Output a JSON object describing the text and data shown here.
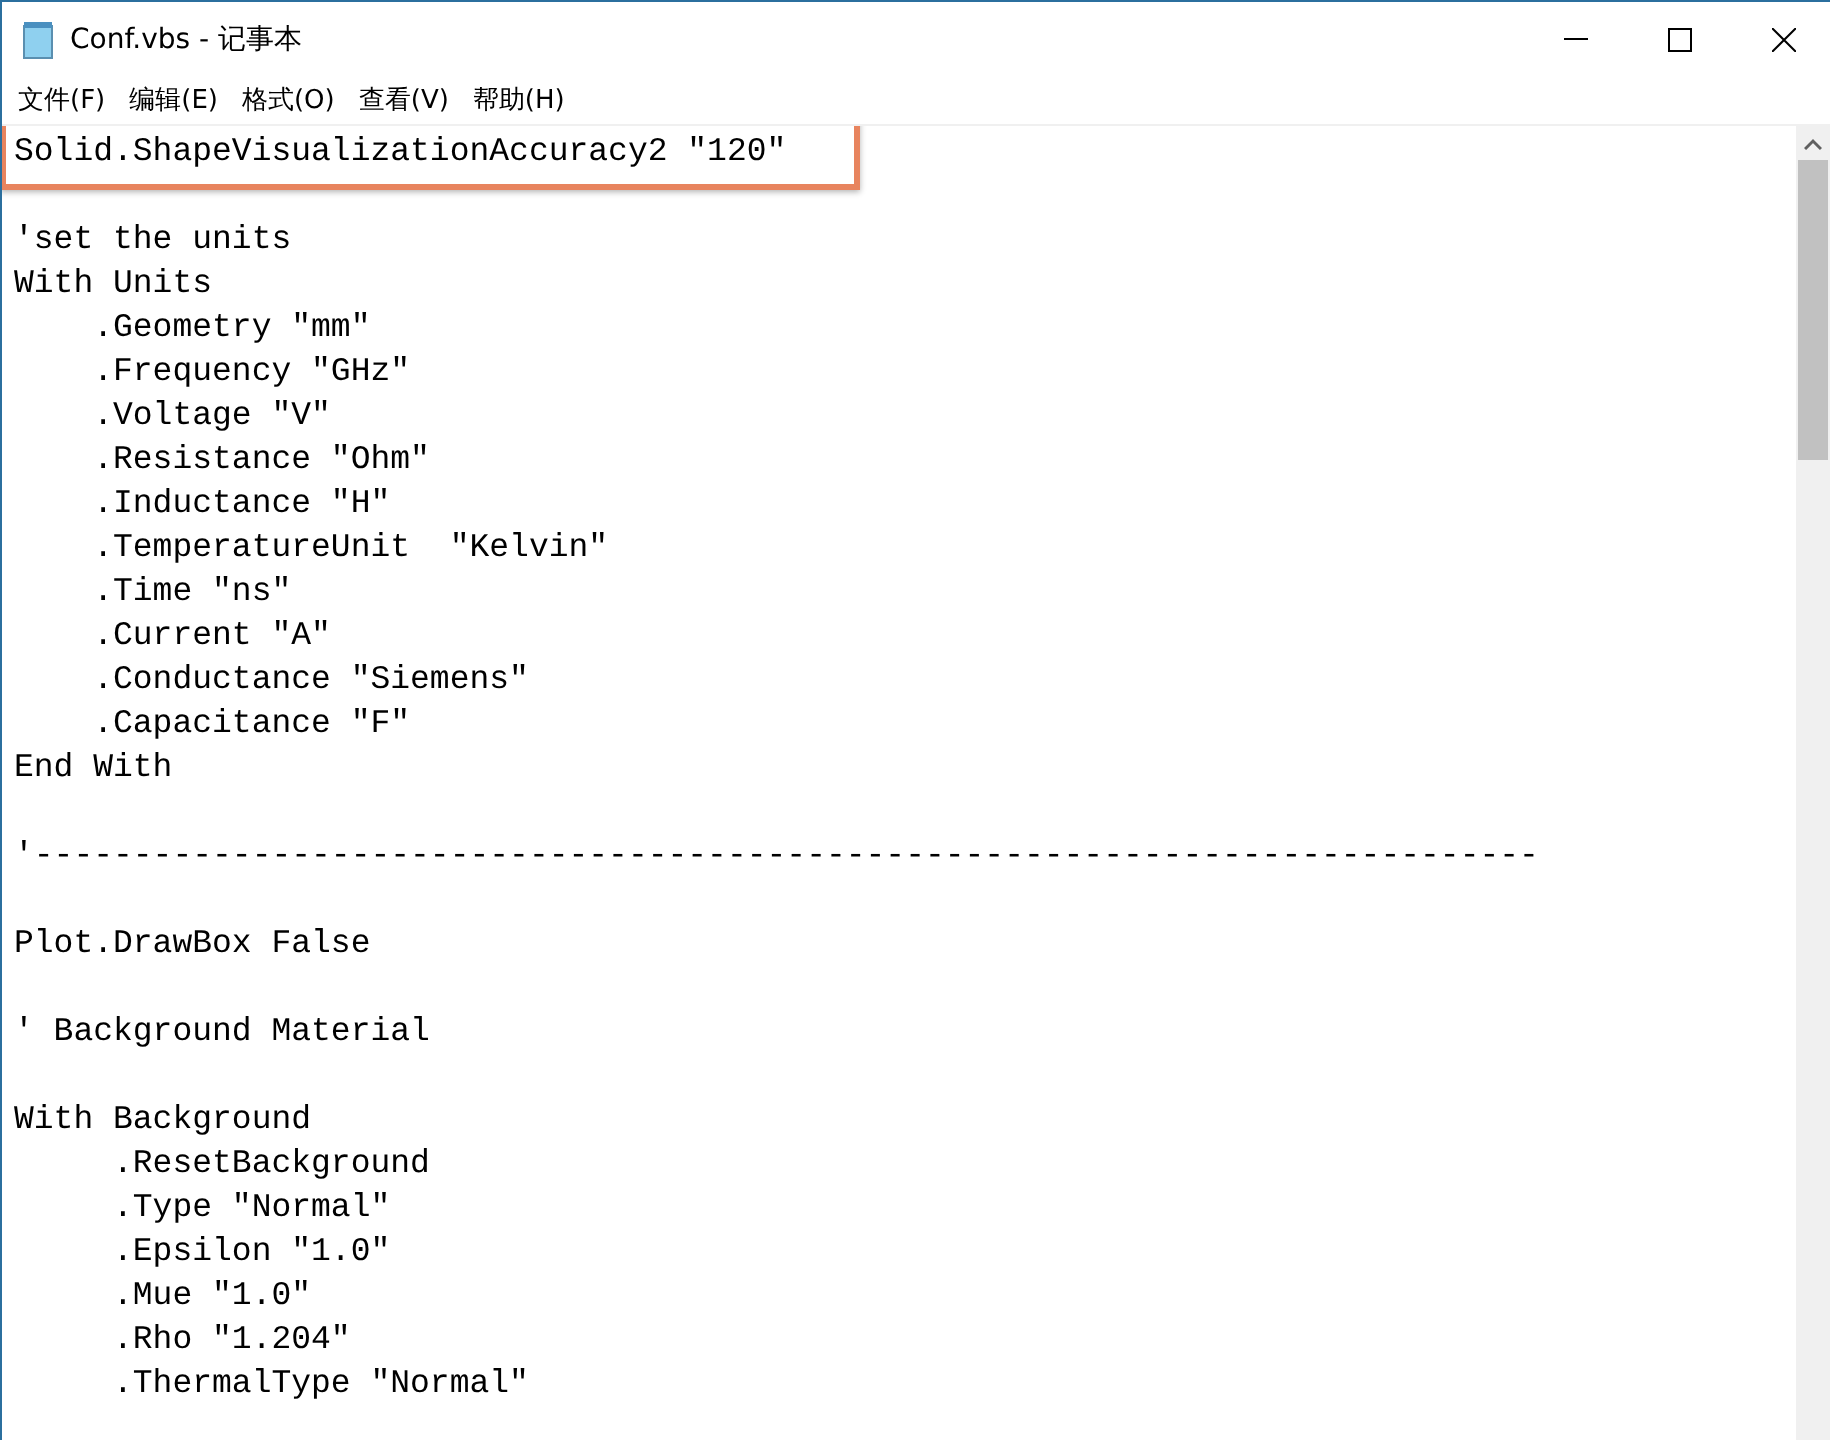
{
  "window": {
    "title": "Conf.vbs - 记事本"
  },
  "menu": [
    "文件(F)",
    "编辑(E)",
    "格式(O)",
    "查看(V)",
    "帮助(H)"
  ],
  "lines": [
    {
      "kind": "code",
      "text": "Solid.ShapeVisualizationAccuracy2 \"120\"",
      "highlighted": true
    },
    {
      "kind": "blank"
    },
    {
      "kind": "code",
      "text": "'set the units",
      "highlighted": false
    },
    {
      "kind": "code",
      "text": "With Units",
      "highlighted": false
    },
    {
      "kind": "code",
      "text": "    .Geometry \"mm\"",
      "highlighted": false
    },
    {
      "kind": "code",
      "text": "    .Frequency \"GHz\"",
      "highlighted": false
    },
    {
      "kind": "code",
      "text": "    .Voltage \"V\"",
      "highlighted": false
    },
    {
      "kind": "code",
      "text": "    .Resistance \"Ohm\"",
      "highlighted": false
    },
    {
      "kind": "code",
      "text": "    .Inductance \"H\"",
      "highlighted": false
    },
    {
      "kind": "code",
      "text": "    .TemperatureUnit  \"Kelvin\"",
      "highlighted": false
    },
    {
      "kind": "code",
      "text": "    .Time \"ns\"",
      "highlighted": false
    },
    {
      "kind": "code",
      "text": "    .Current \"A\"",
      "highlighted": false
    },
    {
      "kind": "code",
      "text": "    .Conductance \"Siemens\"",
      "highlighted": false
    },
    {
      "kind": "code",
      "text": "    .Capacitance \"F\"",
      "highlighted": false
    },
    {
      "kind": "code",
      "text": "End With",
      "highlighted": false
    },
    {
      "kind": "blank"
    },
    {
      "kind": "code",
      "text": "'----------------------------------------------------------------------------",
      "highlighted": false
    },
    {
      "kind": "blank"
    },
    {
      "kind": "code",
      "text": "Plot.DrawBox False",
      "highlighted": false
    },
    {
      "kind": "blank"
    },
    {
      "kind": "code",
      "text": "' Background Material",
      "highlighted": false
    },
    {
      "kind": "blank"
    },
    {
      "kind": "code",
      "text": "With Background",
      "highlighted": false
    },
    {
      "kind": "code",
      "text": "     .ResetBackground",
      "highlighted": false
    },
    {
      "kind": "code",
      "text": "     .Type \"Normal\"",
      "highlighted": false
    },
    {
      "kind": "code",
      "text": "     .Epsilon \"1.0\"",
      "highlighted": false
    },
    {
      "kind": "code",
      "text": "     .Mue \"1.0\"",
      "highlighted": false
    },
    {
      "kind": "code",
      "text": "     .Rho \"1.204\"",
      "highlighted": false
    },
    {
      "kind": "code",
      "text": "     .ThermalType \"Normal\"",
      "highlighted": false
    }
  ]
}
